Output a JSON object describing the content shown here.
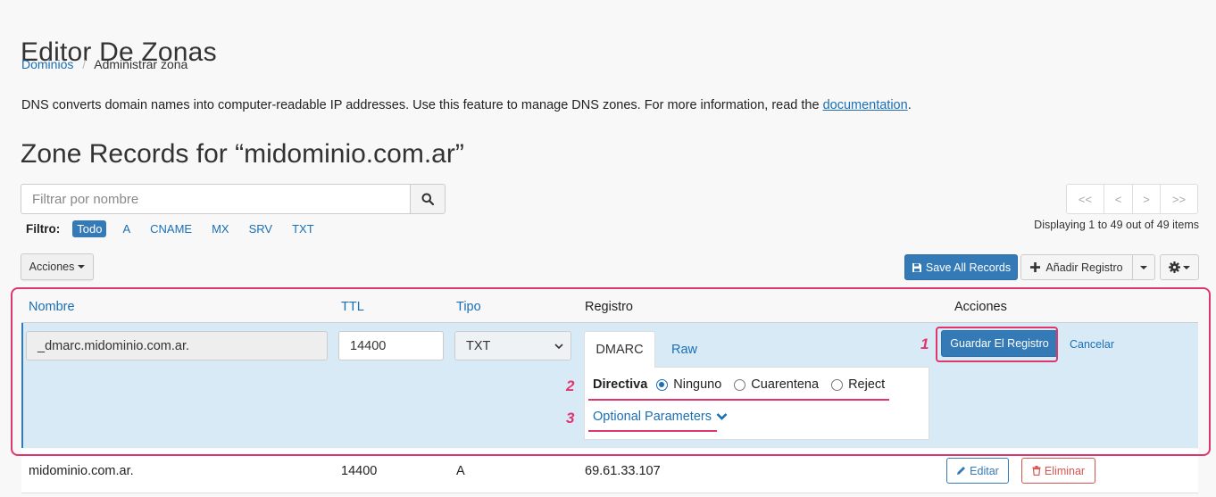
{
  "page": {
    "title": "Editor De Zonas",
    "breadcrumb": {
      "root": "Dominios",
      "separator": "/",
      "current": "Administrar zona"
    },
    "intro_text": "DNS converts domain names into computer-readable IP addresses. Use this feature to manage DNS zones. For more information, read the ",
    "intro_link": "documentation",
    "intro_end": ".",
    "zone_title": "Zone Records for “midominio.com.ar”"
  },
  "search": {
    "placeholder": "Filtrar por nombre",
    "value": ""
  },
  "filter": {
    "label": "Filtro:",
    "options": [
      "Todo",
      "A",
      "CNAME",
      "MX",
      "SRV",
      "TXT"
    ],
    "active": "Todo"
  },
  "pagination": {
    "buttons": [
      "<<",
      "<",
      ">",
      ">>"
    ],
    "summary": "Displaying 1 to 49 out of 49 items"
  },
  "toolbar": {
    "actions_label": "Acciones",
    "save_all_label": "Save All Records",
    "add_record_label": "Añadir Registro",
    "settings_icon": "gear-icon"
  },
  "table": {
    "headers": {
      "name": "Nombre",
      "ttl": "TTL",
      "type": "Tipo",
      "record": "Registro",
      "actions": "Acciones"
    },
    "edit_row": {
      "name": "_dmarc.midominio.com.ar.",
      "ttl": "14400",
      "type": "TXT",
      "tabs": [
        "DMARC",
        "Raw"
      ],
      "active_tab": "DMARC",
      "directive_label": "Directiva",
      "directive_options": [
        "Ninguno",
        "Cuarentena",
        "Reject"
      ],
      "directive_selected": "Ninguno",
      "optional_params_label": "Optional Parameters",
      "save_label": "Guardar El Registro",
      "cancel_label": "Cancelar"
    },
    "rows": [
      {
        "name": "midominio.com.ar.",
        "ttl": "14400",
        "type": "A",
        "record": "69.61.33.107",
        "edit_label": "Editar",
        "delete_label": "Eliminar"
      }
    ]
  },
  "annotations": {
    "markers": [
      "1",
      "2",
      "3"
    ],
    "color": "#e0366e"
  },
  "colors": {
    "primary": "#337ab7",
    "link": "#1a6fb5",
    "danger": "#d9534f",
    "edit_row_bg": "#d9eaf7"
  }
}
